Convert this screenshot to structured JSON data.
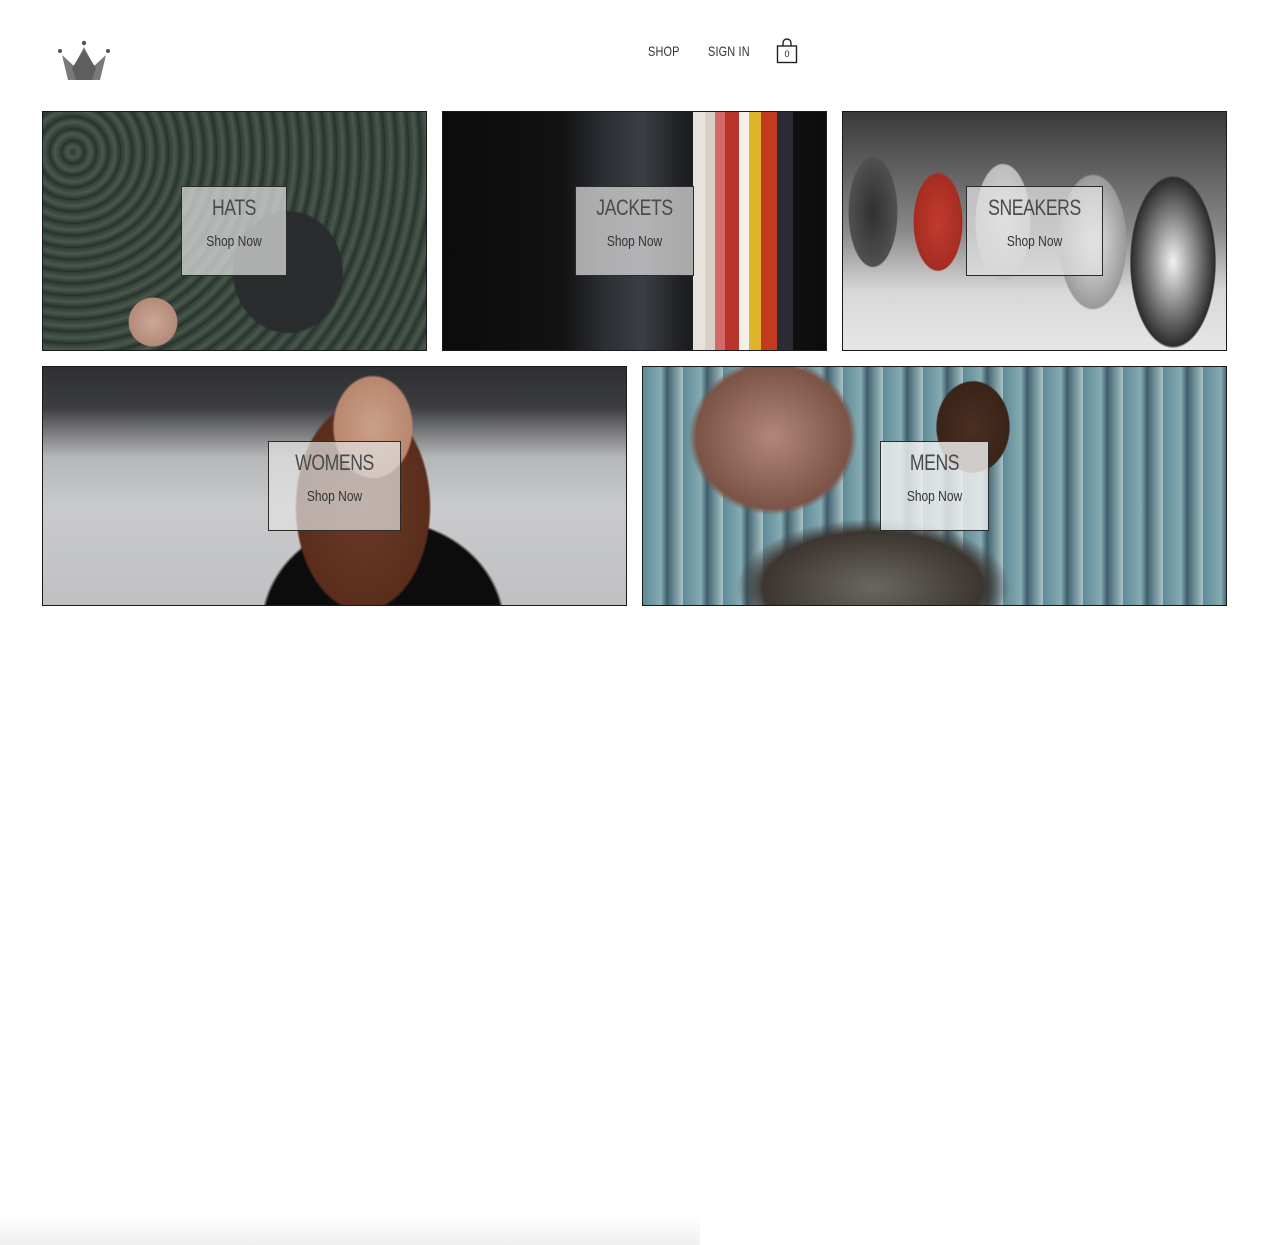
{
  "header": {
    "logo_icon": "crown-icon",
    "nav": {
      "shop": "SHOP",
      "sign_in": "SIGN IN"
    },
    "cart": {
      "icon": "shopping-bag-icon",
      "count": "0"
    }
  },
  "directory": {
    "categories": [
      {
        "title": "HATS",
        "cta": "Shop Now"
      },
      {
        "title": "JACKETS",
        "cta": "Shop Now"
      },
      {
        "title": "SNEAKERS",
        "cta": "Shop Now"
      },
      {
        "title": "WOMENS",
        "cta": "Shop Now"
      },
      {
        "title": "MENS",
        "cta": "Shop Now"
      }
    ]
  }
}
